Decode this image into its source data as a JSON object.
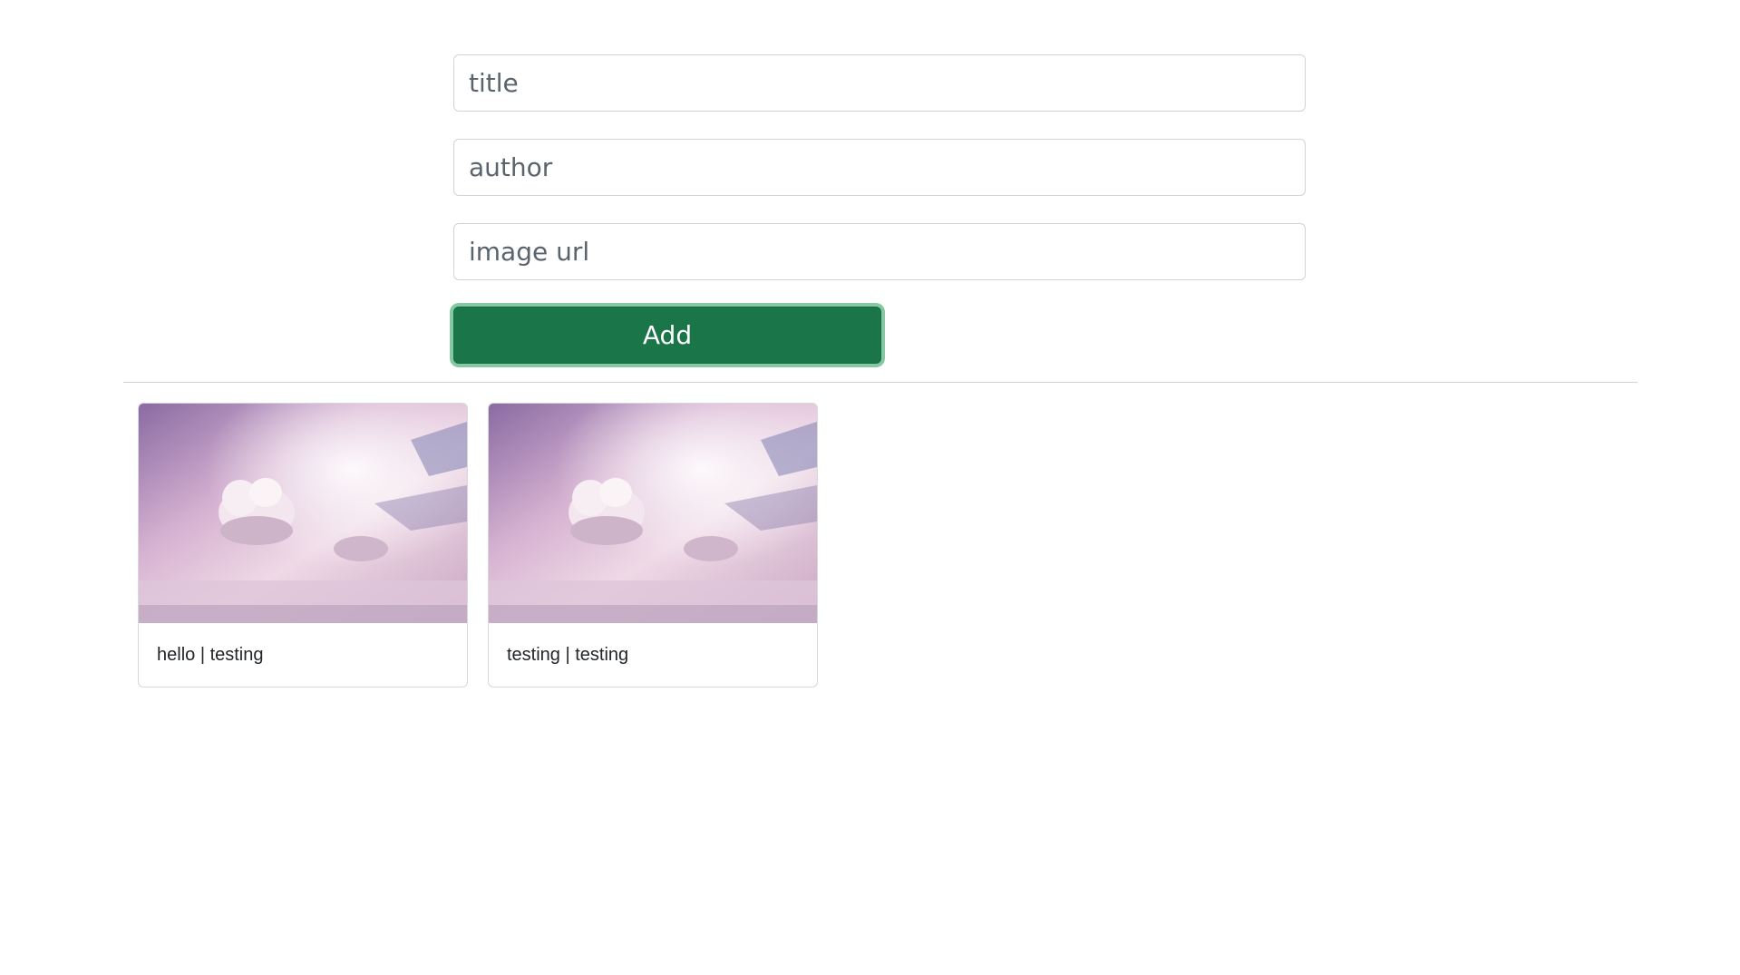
{
  "form": {
    "title_placeholder": "title",
    "author_placeholder": "author",
    "image_url_placeholder": "image url",
    "add_label": "Add"
  },
  "cards": [
    {
      "title": "hello",
      "author": "testing",
      "caption": "hello | testing"
    },
    {
      "title": "testing",
      "author": "testing",
      "caption": "testing | testing"
    }
  ],
  "colors": {
    "add_button": "#1a7549",
    "add_button_focus_ring": "#86c7a4",
    "input_border": "#ced4da",
    "placeholder_text": "#5b646d",
    "card_border": "#d6d8db"
  }
}
